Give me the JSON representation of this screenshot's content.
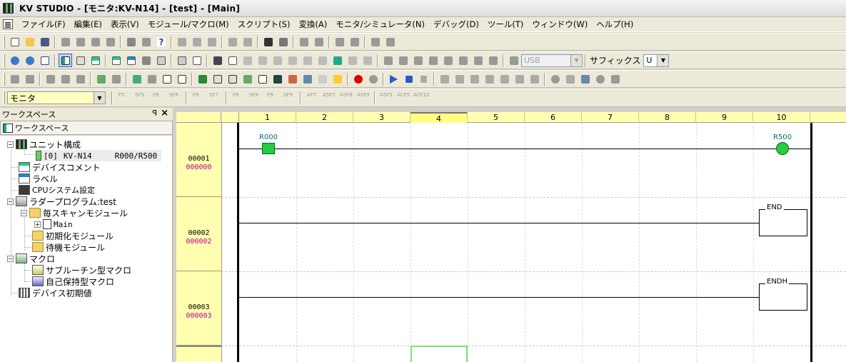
{
  "window": {
    "title": "KV STUDIO - [モニタ:KV-N14] - [test] - [Main]"
  },
  "menu": {
    "items": [
      "ファイル(F)",
      "編集(E)",
      "表示(V)",
      "モジュール/マクロ(M)",
      "スクリプト(S)",
      "変換(A)",
      "モニタ/シミュレータ(N)",
      "デバッグ(D)",
      "ツール(T)",
      "ウィンドウ(W)",
      "ヘルプ(H)"
    ]
  },
  "toolbar2": {
    "connection_value": "USB",
    "suffix_label": "サフィックス",
    "suffix_value": "U"
  },
  "toolbar4": {
    "mode_value": "モニタ",
    "fkeys": [
      "F5",
      "SF5",
      "F6",
      "SF6",
      "F9",
      "SF7",
      "F8",
      "SF8",
      "F9",
      "SF9",
      "AF7",
      "ASF7",
      "ASF8",
      "ASF9",
      "ASF5",
      "ACF5",
      "ACF10"
    ]
  },
  "workspace": {
    "header": "ワークスペース",
    "pin": "ꟼ",
    "close": "×",
    "tab": "ワークスペース",
    "tree": {
      "unit_config": "ユニット構成",
      "unit_slot": "[0]",
      "unit_model": "KV-N14",
      "unit_range": "R000/R500",
      "device_comment": "デバイスコメント",
      "label": "ラベル",
      "cpu_system": "CPUシステム設定",
      "ladder_program": "ラダープログラム:test",
      "every_scan_module": "毎スキャンモジュール",
      "main": "Main",
      "init_module": "初期化モジュール",
      "standby_module": "待機モジュール",
      "macro": "マクロ",
      "subroutine_macro": "サブルーチン型マクロ",
      "self_hold_macro": "自己保持型マクロ",
      "device_init": "デバイス初期値"
    }
  },
  "ladder": {
    "columns": [
      "1",
      "2",
      "3",
      "4",
      "5",
      "6",
      "7",
      "8",
      "9",
      "10"
    ],
    "active_column": "4",
    "rungs": [
      {
        "row": "00001",
        "step": "000000",
        "contact": "R000",
        "coil": "R500"
      },
      {
        "row": "00002",
        "step": "000002",
        "instruction": "END"
      },
      {
        "row": "00003",
        "step": "000003",
        "instruction": "ENDH"
      }
    ]
  }
}
